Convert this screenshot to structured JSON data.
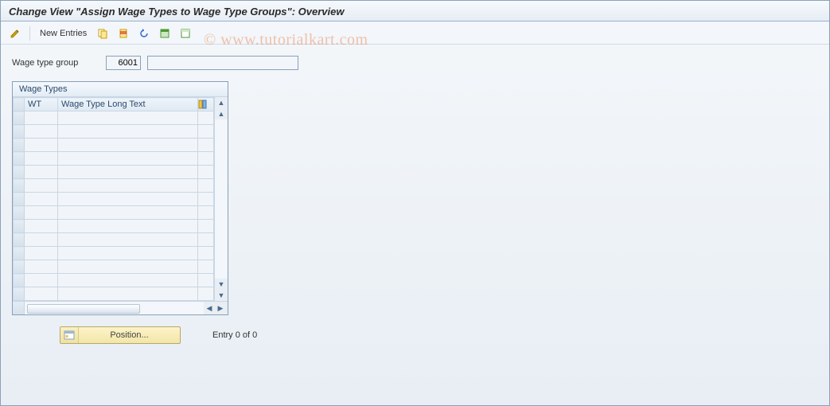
{
  "title": "Change View \"Assign Wage Types to Wage Type Groups\": Overview",
  "toolbar": {
    "new_entries_label": "New Entries",
    "icons": {
      "toggle": "toggle-icon",
      "new": "new-entries-icon",
      "copy": "copy-icon",
      "delete": "delete-icon",
      "undo": "undo-icon",
      "select_all": "select-all-icon",
      "deselect_all": "deselect-all-icon"
    }
  },
  "filter": {
    "label": "Wage type group",
    "code": "6001",
    "description": ""
  },
  "panel": {
    "title": "Wage Types",
    "columns": {
      "wt": "WT",
      "long_text": "Wage Type Long Text"
    },
    "rows": [
      "",
      "",
      "",
      "",
      "",
      "",
      "",
      "",
      "",
      "",
      "",
      "",
      "",
      ""
    ]
  },
  "footer": {
    "position_label": "Position...",
    "entry_text": "Entry 0 of 0"
  },
  "watermark": "© www.tutorialkart.com"
}
